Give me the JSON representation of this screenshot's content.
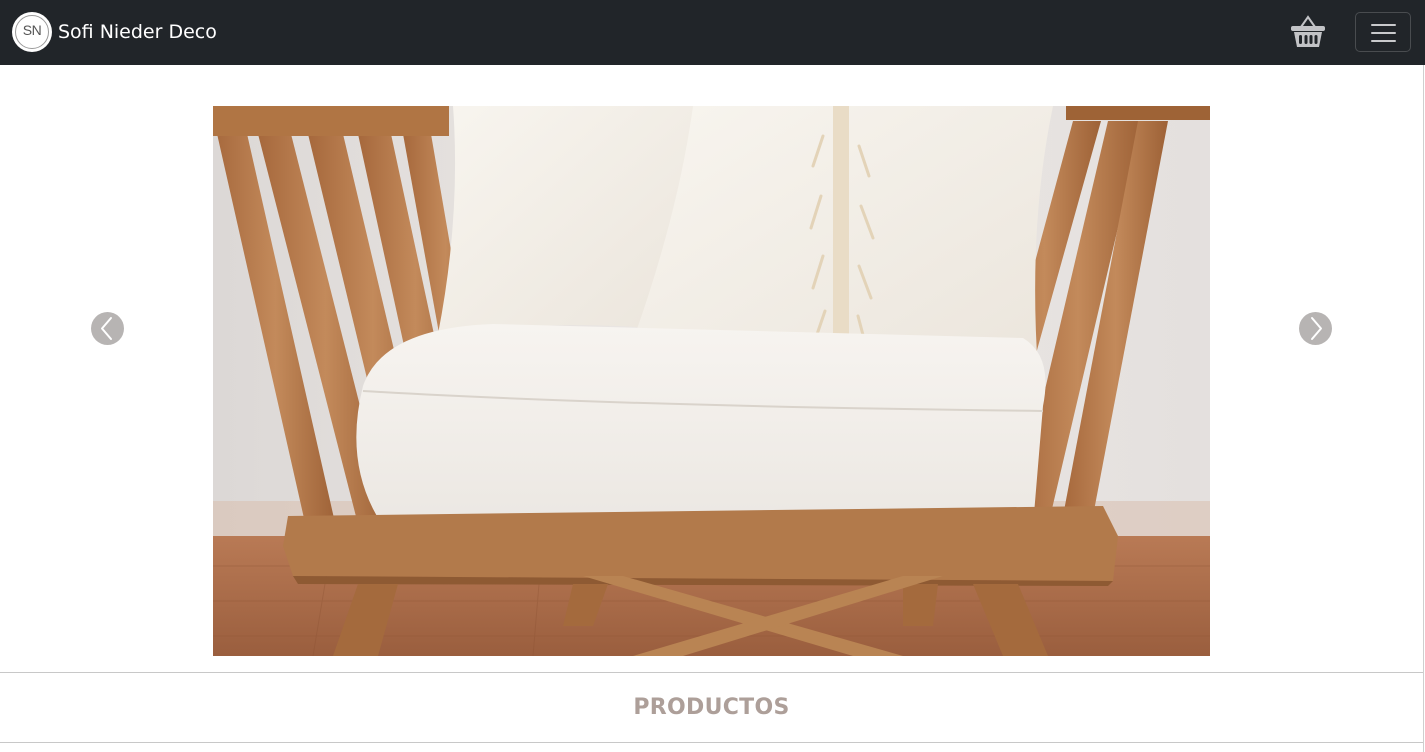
{
  "navbar": {
    "logo_text": "SN",
    "brand_name": "Sofi Nieder Deco",
    "cart_icon": "basket-icon",
    "menu_icon": "hamburger-menu-icon",
    "background": "#212529"
  },
  "carousel": {
    "slide_image": "wooden-armchair-with-white-cushions-photo",
    "prev_icon": "chevron-left-icon",
    "next_icon": "chevron-right-icon"
  },
  "section": {
    "title": "PRODUCTOS",
    "title_color": "#ad9f99"
  }
}
